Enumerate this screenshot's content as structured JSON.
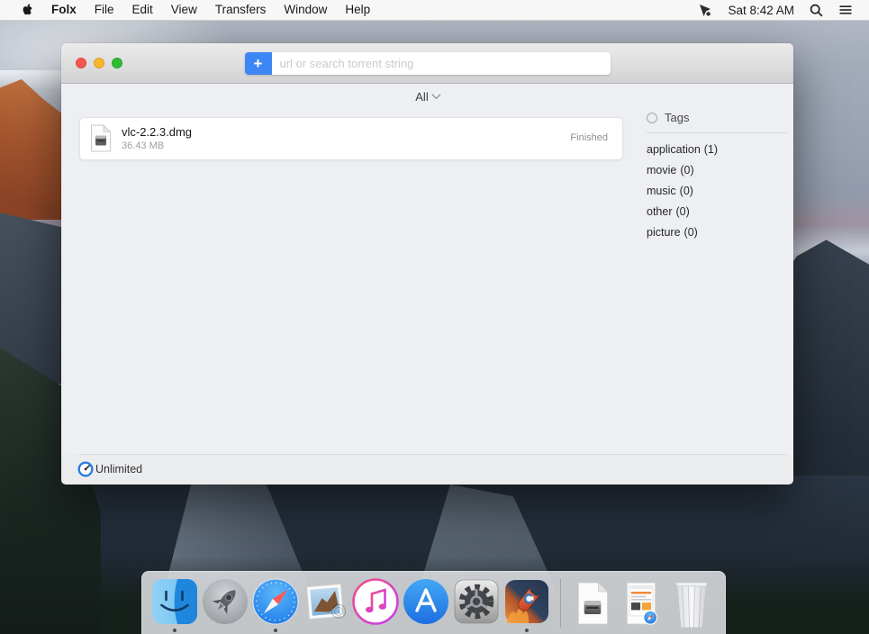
{
  "menu_bar": {
    "menus": [
      {
        "label": "Folx"
      },
      {
        "label": "File"
      },
      {
        "label": "Edit"
      },
      {
        "label": "View"
      },
      {
        "label": "Transfers"
      },
      {
        "label": "Window"
      },
      {
        "label": "Help"
      }
    ],
    "clock": "Sat 8:42 AM"
  },
  "window": {
    "search_bar": {
      "add_button_label": "+",
      "placeholder": "url or search torrent string"
    },
    "filter_dropdown": {
      "value": "All"
    },
    "downloads": [
      {
        "name": "vlc-2.2.3.dmg",
        "size": "36.43 MB",
        "status": "Finished"
      }
    ],
    "tags_panel": {
      "title": "Tags",
      "tags": [
        {
          "label": "application",
          "count": "(1)"
        },
        {
          "label": "movie",
          "count": "(0)"
        },
        {
          "label": "music",
          "count": "(0)"
        },
        {
          "label": "other",
          "count": "(0)"
        },
        {
          "label": "picture",
          "count": "(0)"
        }
      ]
    },
    "status_bar": {
      "speed_mode": "Unlimited"
    }
  },
  "dock": {
    "apps": [
      {
        "name": "finder",
        "running": true
      },
      {
        "name": "launchpad",
        "running": false
      },
      {
        "name": "safari",
        "running": true
      },
      {
        "name": "mail",
        "running": false
      },
      {
        "name": "itunes",
        "running": false
      },
      {
        "name": "app-store",
        "running": false
      },
      {
        "name": "system-preferences",
        "running": false
      },
      {
        "name": "folx",
        "running": true
      }
    ],
    "files": [
      {
        "name": "dmg-file"
      },
      {
        "name": "webpage-file"
      }
    ],
    "trash": {
      "name": "trash"
    }
  },
  "colors": {
    "accent_blue": "#3d87f5",
    "traffic_red": "#f6574f",
    "traffic_yellow": "#f9b52f",
    "traffic_green": "#2ebc33"
  }
}
